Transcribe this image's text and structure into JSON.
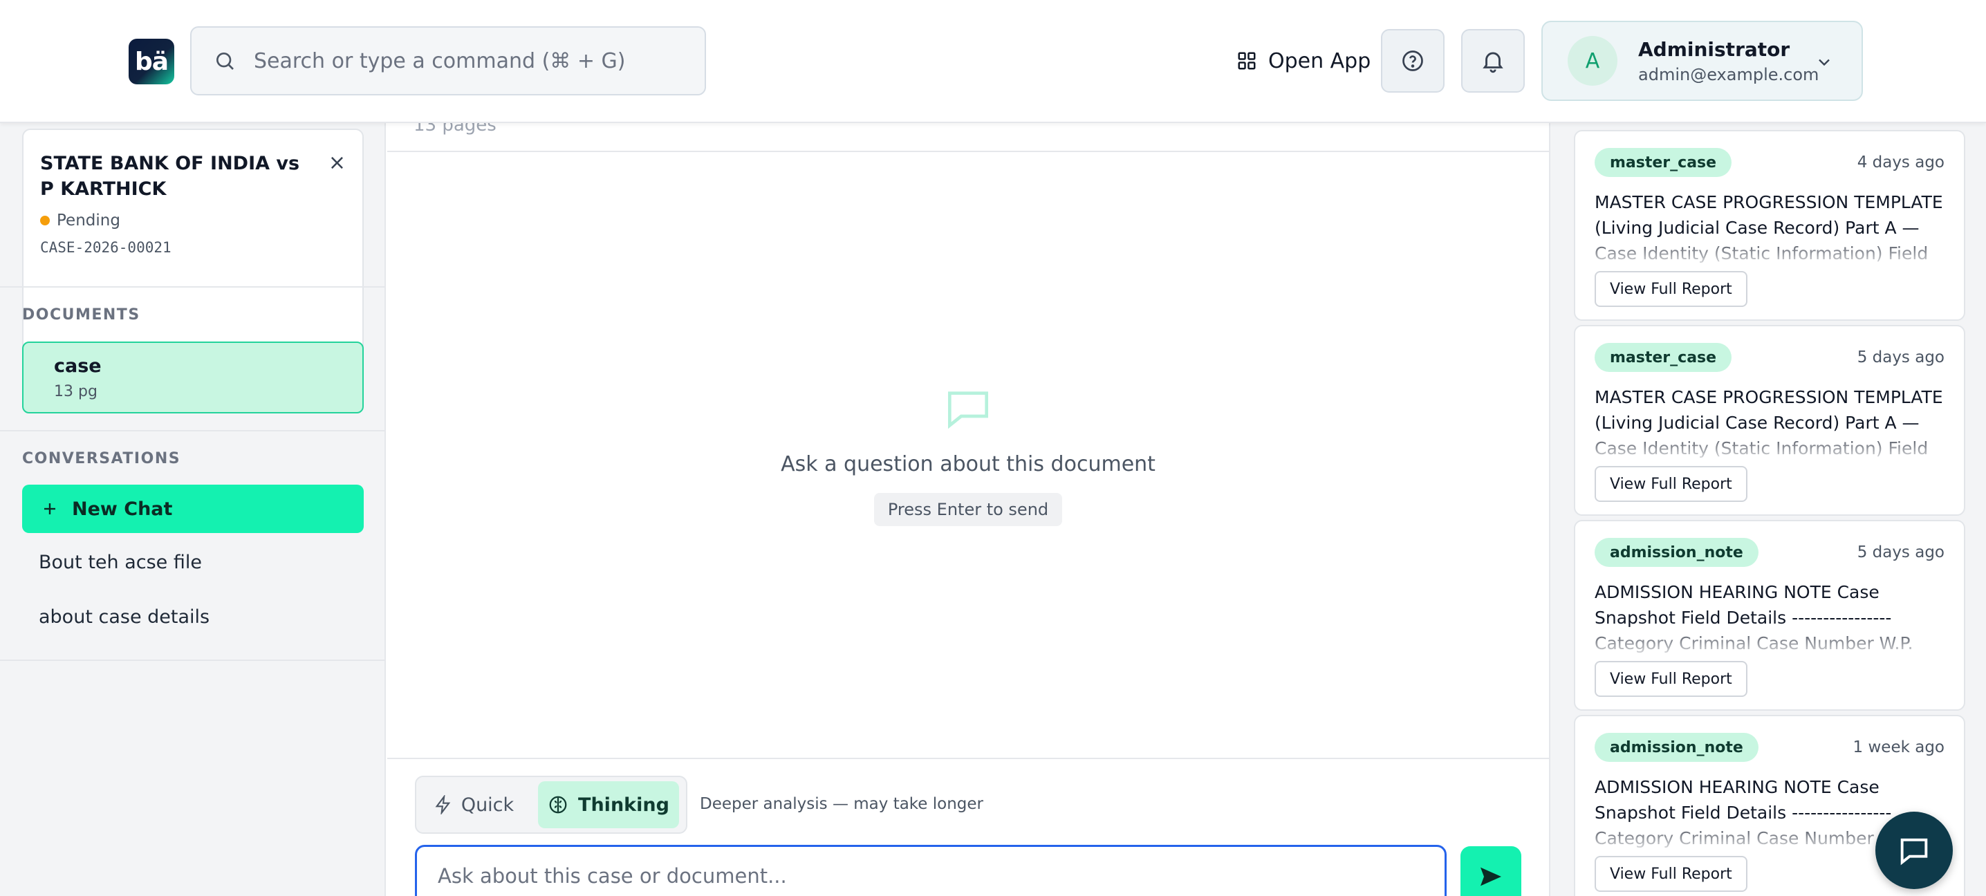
{
  "header": {
    "logo_text": "bä",
    "search_placeholder": "Search or type a command (⌘ + G)",
    "open_app_label": "Open App",
    "user": {
      "initial": "A",
      "name": "Administrator",
      "email": "admin@example.com"
    }
  },
  "sidebar": {
    "case": {
      "title": "STATE BANK OF INDIA vs P KARTHICK",
      "status": "Pending",
      "status_color": "#f59e0b",
      "id": "CASE-2026-00021",
      "close_symbol": "×"
    },
    "documents_label": "DOCUMENTS",
    "documents": [
      {
        "name": "case",
        "pages": "13 pg"
      }
    ],
    "conversations_label": "CONVERSATIONS",
    "new_chat_label": "New Chat",
    "conversations": [
      {
        "title": "Bout teh acse file"
      },
      {
        "title": "about case details"
      }
    ]
  },
  "main": {
    "doc_pages_text": "13 pages",
    "empty_prompt": "Ask a question about this document",
    "empty_hint": "Press Enter to send",
    "mode": {
      "quick_label": "Quick",
      "thinking_label": "Thinking",
      "selected": "Thinking",
      "description": "Deeper analysis — may take longer"
    },
    "input_placeholder": "Ask about this case or document..."
  },
  "reports": [
    {
      "tag": "master_case",
      "age": "4 days ago",
      "excerpt": "MASTER CASE PROGRESSION TEMPLATE (Living Judicial Case Record) Part A — Case Identity (Static Information) Field",
      "button": "View Full Report"
    },
    {
      "tag": "master_case",
      "age": "5 days ago",
      "excerpt": "MASTER CASE PROGRESSION TEMPLATE (Living Judicial Case Record) Part A — Case Identity (Static Information) Field",
      "button": "View Full Report"
    },
    {
      "tag": "admission_note",
      "age": "5 days ago",
      "excerpt": "ADMISSION HEARING NOTE Case Snapshot Field Details ---------------- Category Criminal Case Number W.P.",
      "button": "View Full Report"
    },
    {
      "tag": "admission_note",
      "age": "1 week ago",
      "excerpt": "ADMISSION HEARING NOTE Case Snapshot Field Details ---------------- Category Criminal Case Number W.P.",
      "button": "View Full Report"
    }
  ],
  "colors": {
    "accent": "#14f1b0",
    "accent_soft": "#c8f6e1",
    "fab": "#0e3a4a",
    "input_focus": "#2563eb"
  }
}
